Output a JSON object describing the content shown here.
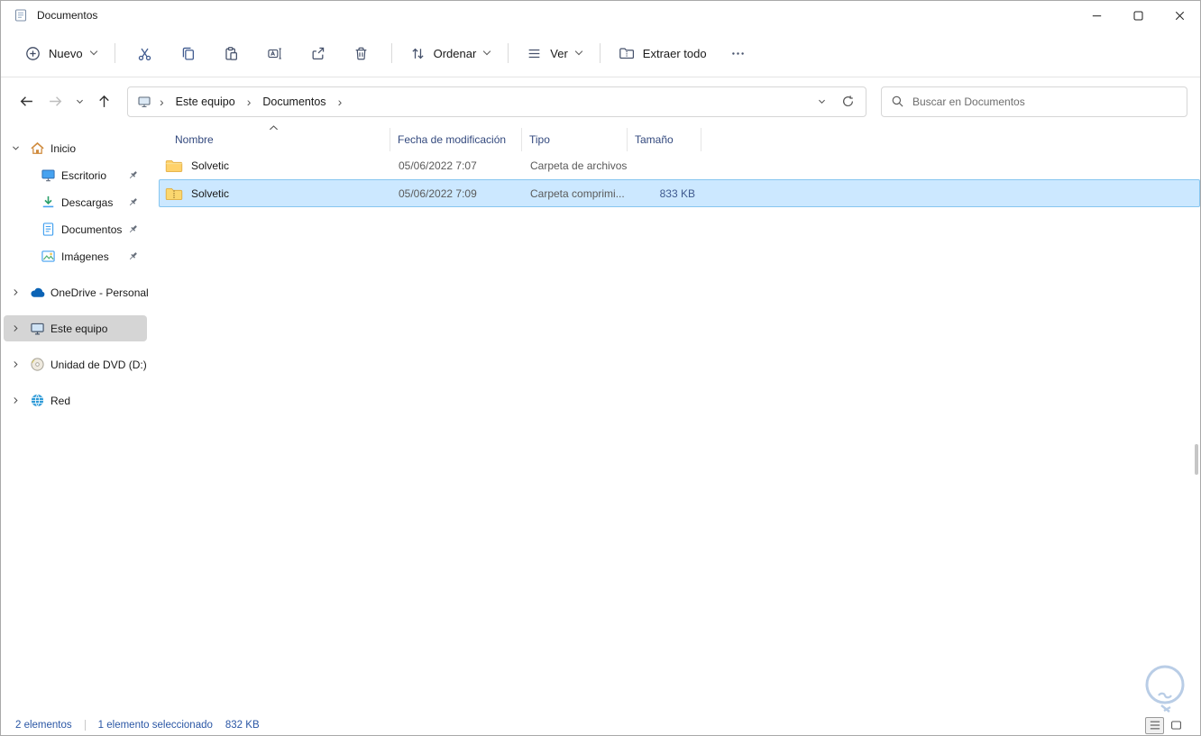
{
  "titlebar": {
    "title": "Documentos"
  },
  "toolbar": {
    "new_label": "Nuevo",
    "sort_label": "Ordenar",
    "view_label": "Ver",
    "extract_label": "Extraer todo"
  },
  "navbar": {
    "breadcrumb_root": "Este equipo",
    "breadcrumb_current": "Documentos",
    "separator": "›",
    "search_placeholder": "Buscar en Documentos"
  },
  "sidebar": {
    "items": [
      {
        "label": "Inicio",
        "icon": "home-icon",
        "expanded": true,
        "pinned": false,
        "selected": false
      },
      {
        "label": "Escritorio",
        "icon": "desktop-icon",
        "pinned": true,
        "selected": false
      },
      {
        "label": "Descargas",
        "icon": "downloads-icon",
        "pinned": true,
        "selected": false
      },
      {
        "label": "Documentos",
        "icon": "documents-icon",
        "pinned": true,
        "selected": false
      },
      {
        "label": "Imágenes",
        "icon": "pictures-icon",
        "pinned": true,
        "selected": false
      },
      {
        "label": "OneDrive - Personal",
        "icon": "onedrive-icon",
        "pinned": false,
        "selected": false
      },
      {
        "label": "Este equipo",
        "icon": "this-pc-icon",
        "pinned": false,
        "selected": true
      },
      {
        "label": "Unidad de DVD (D:)",
        "icon": "dvd-icon",
        "pinned": false,
        "selected": false
      },
      {
        "label": "Red",
        "icon": "network-icon",
        "pinned": false,
        "selected": false
      }
    ]
  },
  "filelist": {
    "columns": [
      {
        "label": "Nombre",
        "sorted": "asc"
      },
      {
        "label": "Fecha de modificación",
        "sorted": ""
      },
      {
        "label": "Tipo",
        "sorted": ""
      },
      {
        "label": "Tamaño",
        "sorted": ""
      }
    ],
    "rows": [
      {
        "name": "Solvetic",
        "date": "05/06/2022 7:07",
        "type": "Carpeta de archivos",
        "size": "",
        "icon": "folder-icon",
        "selected": false
      },
      {
        "name": "Solvetic",
        "date": "05/06/2022 7:09",
        "type": "Carpeta comprimi...",
        "size": "833 KB",
        "icon": "zip-folder-icon",
        "selected": true
      }
    ]
  },
  "statusbar": {
    "items_count": "2 elementos",
    "selection_info": "1 elemento seleccionado",
    "selection_size": "832 KB"
  },
  "colors": {
    "accent": "#0078d4",
    "selection_bg": "#cce8ff",
    "selection_border": "#86c6f0",
    "sidebar_selected_bg": "#d5d5d5",
    "folder_yellow": "#ffd26b"
  }
}
